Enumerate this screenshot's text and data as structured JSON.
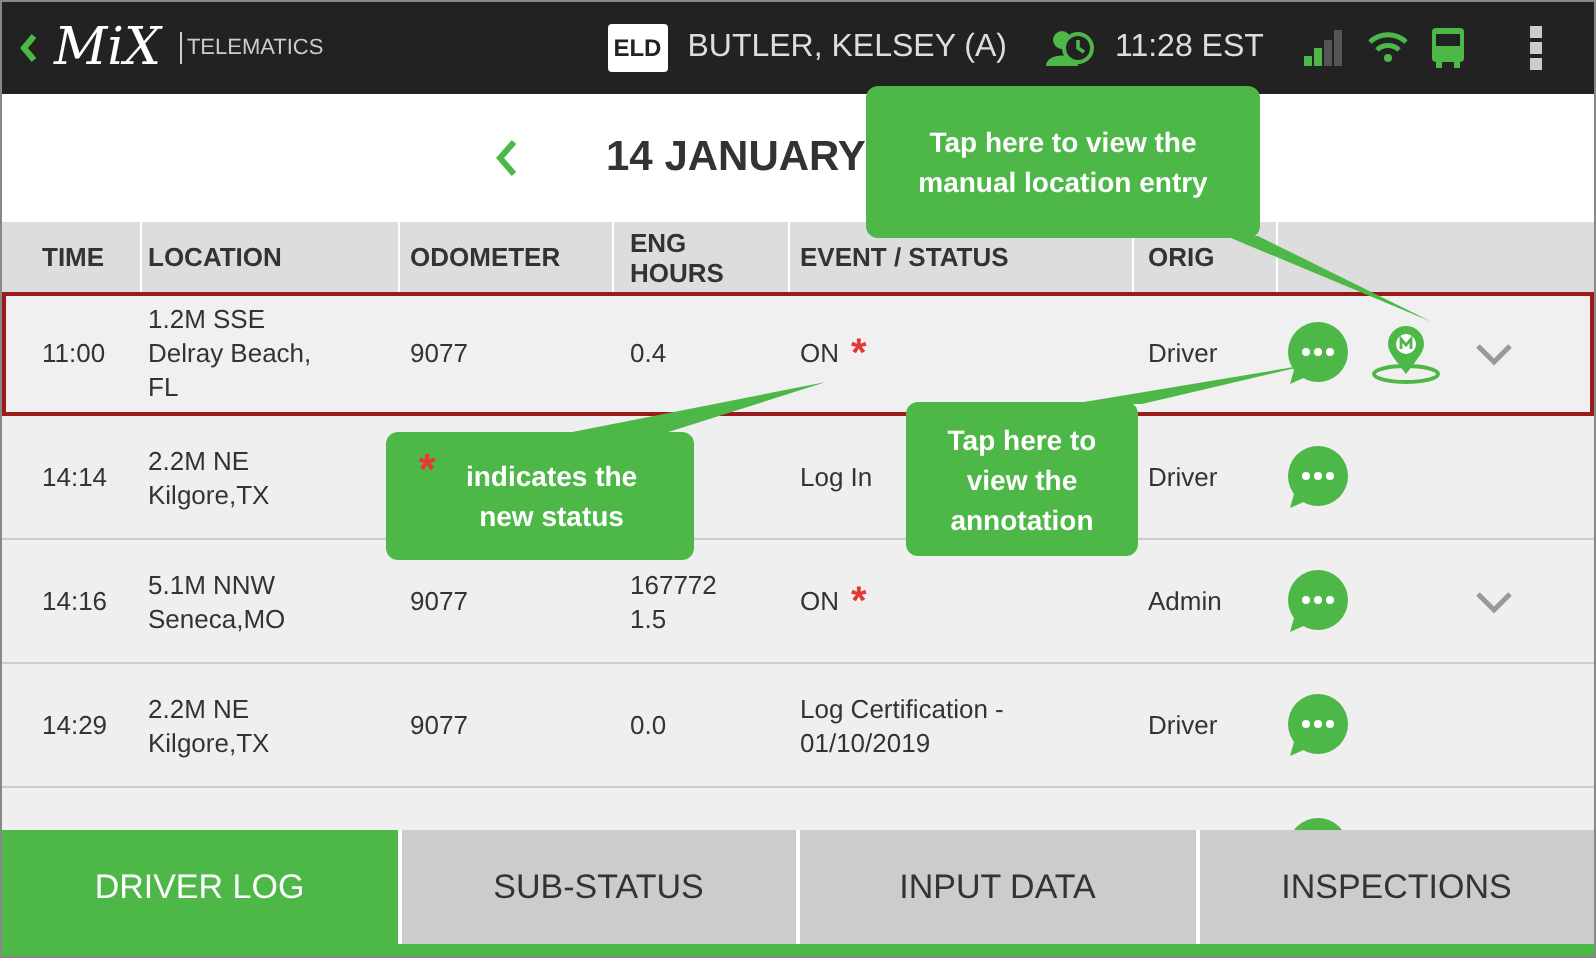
{
  "top_bar": {
    "logo": "MiX",
    "brand": "TELEMATICS",
    "eld_badge": "ELD",
    "driver": "BUTLER, KELSEY (A)",
    "time": "11:28 EST"
  },
  "date_header": {
    "date": "14 JANUARY"
  },
  "table": {
    "columns": [
      "TIME",
      "LOCATION",
      "ODOMETER",
      "ENG HOURS",
      "EVENT / STATUS",
      "ORIG"
    ],
    "rows": [
      {
        "time": "11:00",
        "location": "1.2M SSE Delray Beach, FL",
        "odometer": "9077",
        "eng_hours": "0.4",
        "event": "ON",
        "status_mark": "*",
        "origin": "Driver",
        "annotation": true,
        "location_entry": true,
        "expandable": true,
        "selected": true
      },
      {
        "time": "14:14",
        "location": "2.2M NE Kilgore,TX",
        "event": "Log In",
        "origin": "Driver",
        "annotation": true,
        "location_entry": false,
        "expandable": false,
        "selected": false
      },
      {
        "time": "14:16",
        "location": "5.1M NNW Seneca,MO",
        "odometer": "9077",
        "eng_hours": "167772 1.5",
        "event": "ON",
        "status_mark": "*",
        "origin": "Admin",
        "annotation": true,
        "location_entry": false,
        "expandable": true,
        "selected": false
      },
      {
        "time": "14:29",
        "location": "2.2M NE Kilgore,TX",
        "odometer": "9077",
        "eng_hours": "0.0",
        "event": "Log Certification - 01/10/2019",
        "origin": "Driver",
        "annotation": true,
        "location_entry": false,
        "expandable": false,
        "selected": false
      },
      {
        "annotation": true,
        "location_entry": false,
        "expandable": false,
        "selected": false
      }
    ]
  },
  "tabs": [
    {
      "label": "DRIVER LOG",
      "selected": true
    },
    {
      "label": "SUB-STATUS",
      "selected": false
    },
    {
      "label": "INPUT DATA",
      "selected": false
    },
    {
      "label": "INSPECTIONS",
      "selected": false
    }
  ],
  "callouts": [
    {
      "kind": "location",
      "text": "Tap here to view the manual location entry"
    },
    {
      "kind": "status",
      "text": "indicates the new status",
      "mark": "*"
    },
    {
      "kind": "annotation",
      "text": "Tap here to view the annotation"
    }
  ]
}
